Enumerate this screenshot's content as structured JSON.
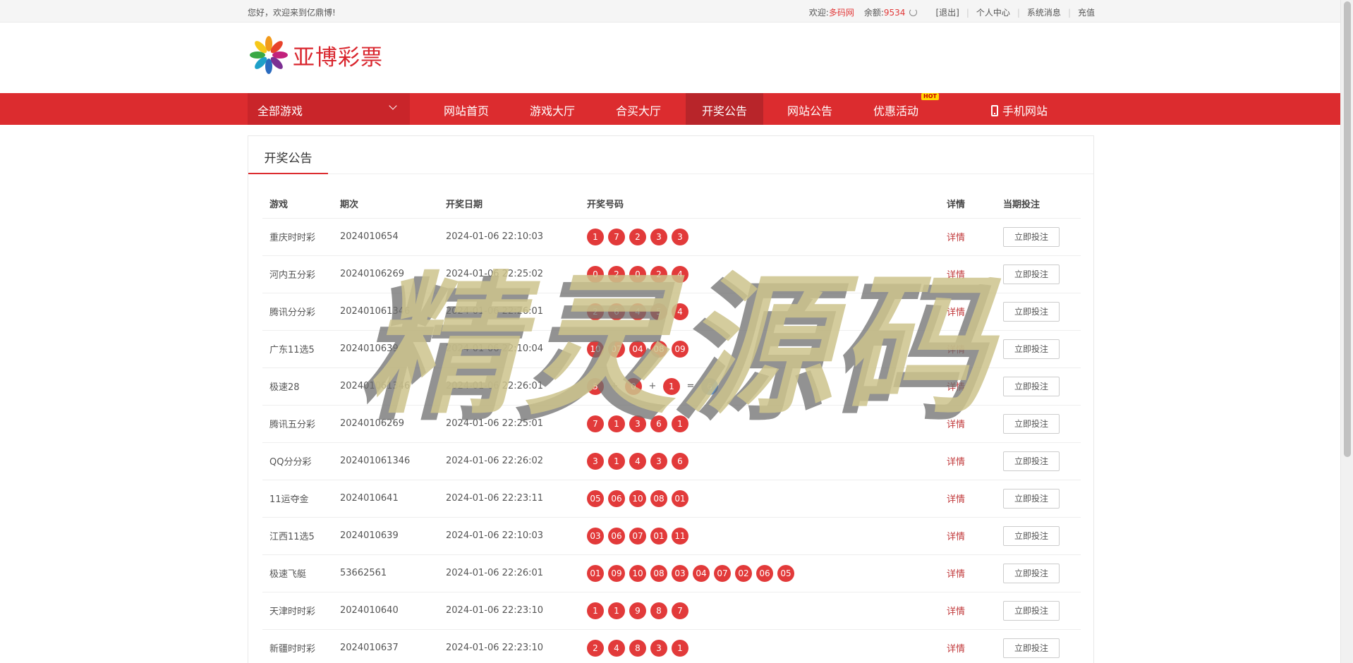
{
  "topbar": {
    "greeting": "您好，欢迎来到亿鼎博!",
    "welcome_label": "欢迎:",
    "username": "多码网",
    "balance_label": "余额:",
    "balance": "9534",
    "logout": "[退出]",
    "personal_center": "个人中心",
    "system_messages": "系统消息",
    "recharge": "充值"
  },
  "header": {
    "logo_text": "亚博彩票"
  },
  "nav": {
    "all_games": "全部游戏",
    "items": [
      "网站首页",
      "游戏大厅",
      "合买大厅",
      "开奖公告",
      "网站公告",
      "优惠活动"
    ],
    "active_item": "开奖公告",
    "hot_badge": "HOT",
    "mobile_site": "手机网站"
  },
  "panel": {
    "title": "开奖公告",
    "columns": [
      "游戏",
      "期次",
      "开奖日期",
      "开奖号码",
      "详情",
      "当期投注"
    ],
    "detail_label": "详情",
    "bet_label": "立即投注",
    "rows": [
      {
        "game": "重庆时时彩",
        "issue": "2024010654",
        "date": "2024-01-06 22:10:03",
        "numbers": [
          "1",
          "7",
          "2",
          "3",
          "3"
        ]
      },
      {
        "game": "河内五分彩",
        "issue": "20240106269",
        "date": "2024-01-06 22:25:02",
        "numbers": [
          "0",
          "2",
          "0",
          "2",
          "4"
        ]
      },
      {
        "game": "腾讯分分彩",
        "issue": "202401061346",
        "date": "2024-01-06 22:26:01",
        "numbers": [
          "2",
          "6",
          "4",
          "5",
          "4"
        ]
      },
      {
        "game": "广东11选5",
        "issue": "2024010639",
        "date": "2024-01-06 22:10:04",
        "numbers": [
          "10",
          "07",
          "04",
          "08",
          "09"
        ]
      },
      {
        "game": "极速28",
        "issue": "202401061346",
        "date": "2024-01-06 22:26:01",
        "numbers": [
          "5",
          "+",
          "0",
          "+",
          "1",
          "=",
          "6"
        ]
      },
      {
        "game": "腾讯五分彩",
        "issue": "20240106269",
        "date": "2024-01-06 22:25:01",
        "numbers": [
          "7",
          "1",
          "3",
          "6",
          "1"
        ]
      },
      {
        "game": "QQ分分彩",
        "issue": "202401061346",
        "date": "2024-01-06 22:26:02",
        "numbers": [
          "3",
          "1",
          "4",
          "3",
          "6"
        ]
      },
      {
        "game": "11运夺金",
        "issue": "2024010641",
        "date": "2024-01-06 22:23:11",
        "numbers": [
          "05",
          "06",
          "10",
          "08",
          "01"
        ]
      },
      {
        "game": "江西11选5",
        "issue": "2024010639",
        "date": "2024-01-06 22:10:03",
        "numbers": [
          "03",
          "06",
          "07",
          "01",
          "11"
        ]
      },
      {
        "game": "极速飞艇",
        "issue": "53662561",
        "date": "2024-01-06 22:26:01",
        "numbers": [
          "01",
          "09",
          "10",
          "08",
          "03",
          "04",
          "07",
          "02",
          "06",
          "05"
        ]
      },
      {
        "game": "天津时时彩",
        "issue": "2024010640",
        "date": "2024-01-06 22:23:10",
        "numbers": [
          "1",
          "1",
          "9",
          "8",
          "7"
        ]
      },
      {
        "game": "新疆时时彩",
        "issue": "2024010637",
        "date": "2024-01-06 22:23:10",
        "numbers": [
          "2",
          "4",
          "8",
          "3",
          "1"
        ]
      }
    ]
  },
  "watermark": "精灵源码",
  "colors": {
    "brand_red": "#dc2c2f",
    "ball_red": "#e23a3a",
    "ball_blue": "#5a8fd1"
  }
}
